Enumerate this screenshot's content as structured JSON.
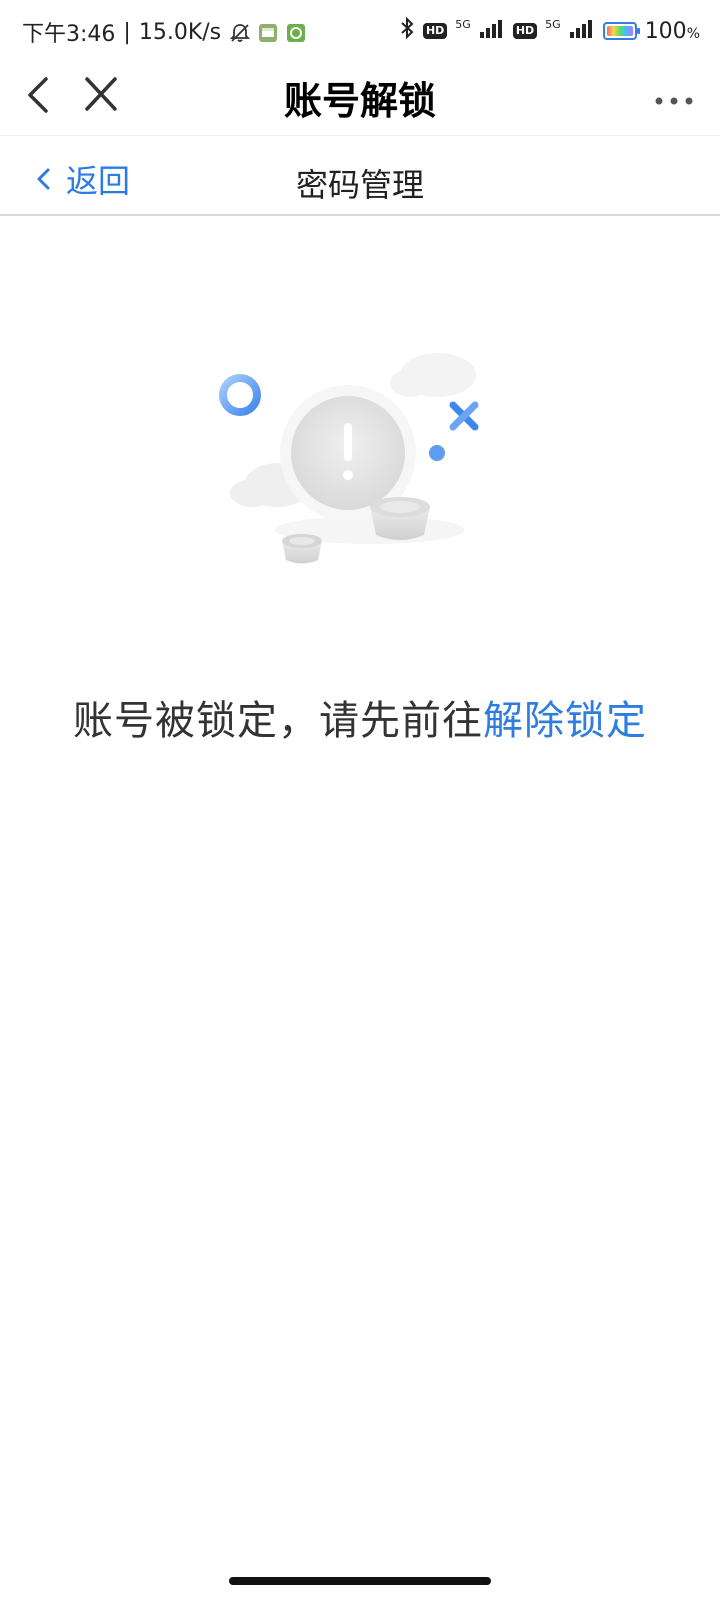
{
  "status_bar": {
    "time": "下午3:46",
    "separator": "|",
    "net_speed": "15.0K/s",
    "hd_label": "HD",
    "net_type": "5G",
    "battery_percent": "100",
    "battery_unit": "%",
    "icons": [
      "mute-bell-icon",
      "app-notification-icon",
      "app-notification-icon",
      "bluetooth-icon",
      "signal-icon",
      "battery-icon"
    ]
  },
  "title_bar": {
    "title": "账号解锁",
    "icons": [
      "back-arrow-icon",
      "close-icon",
      "more-icon"
    ]
  },
  "sub_header": {
    "back_label": "返回",
    "title": "密码管理"
  },
  "message": {
    "text": "账号被锁定，请先前往",
    "link": "解除锁定"
  },
  "colors": {
    "accent": "#2f7ddf",
    "text": "#333333",
    "title": "#000000"
  }
}
